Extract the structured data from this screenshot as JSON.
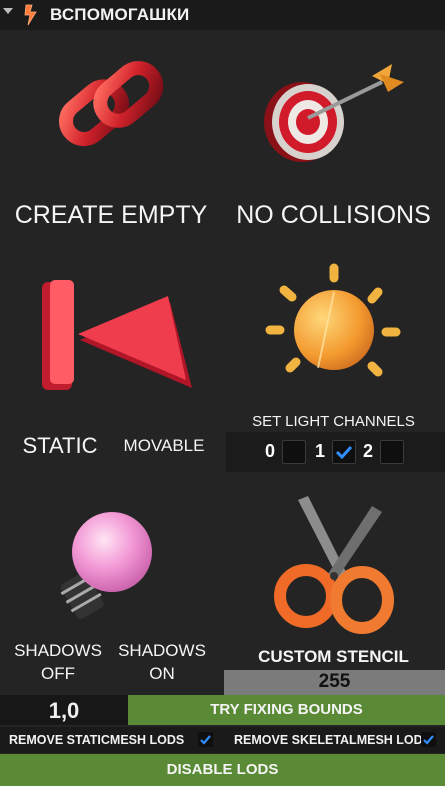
{
  "header": {
    "title": "ВСПОМОГАШКИ"
  },
  "tiles": {
    "create_empty": "CREATE EMPTY",
    "no_collisions": "NO COLLISIONS",
    "static": "STATIC",
    "movable": "MOVABLE",
    "set_light_channels": "SET LIGHT CHANNELS",
    "shadows_off": [
      "SHADOWS",
      "OFF"
    ],
    "shadows_on": [
      "SHADOWS",
      "ON"
    ],
    "custom_stencil": "CUSTOM STENCIL"
  },
  "channels": [
    {
      "label": "0",
      "checked": false
    },
    {
      "label": "1",
      "checked": true
    },
    {
      "label": "2",
      "checked": false
    }
  ],
  "stencil_value": "255",
  "bounds_value": "1,0",
  "try_bounds_label": "TRY FIXING BOUNDS",
  "lods": {
    "static_label": "REMOVE STATICMESH LODS",
    "static_checked": true,
    "skeletal_label": "REMOVE SKELETALMESH LODS",
    "skeletal_checked": true
  },
  "disable_lods_label": "DISABLE LODS",
  "colors": {
    "green": "#5a8a36",
    "check": "#2f8fff"
  }
}
